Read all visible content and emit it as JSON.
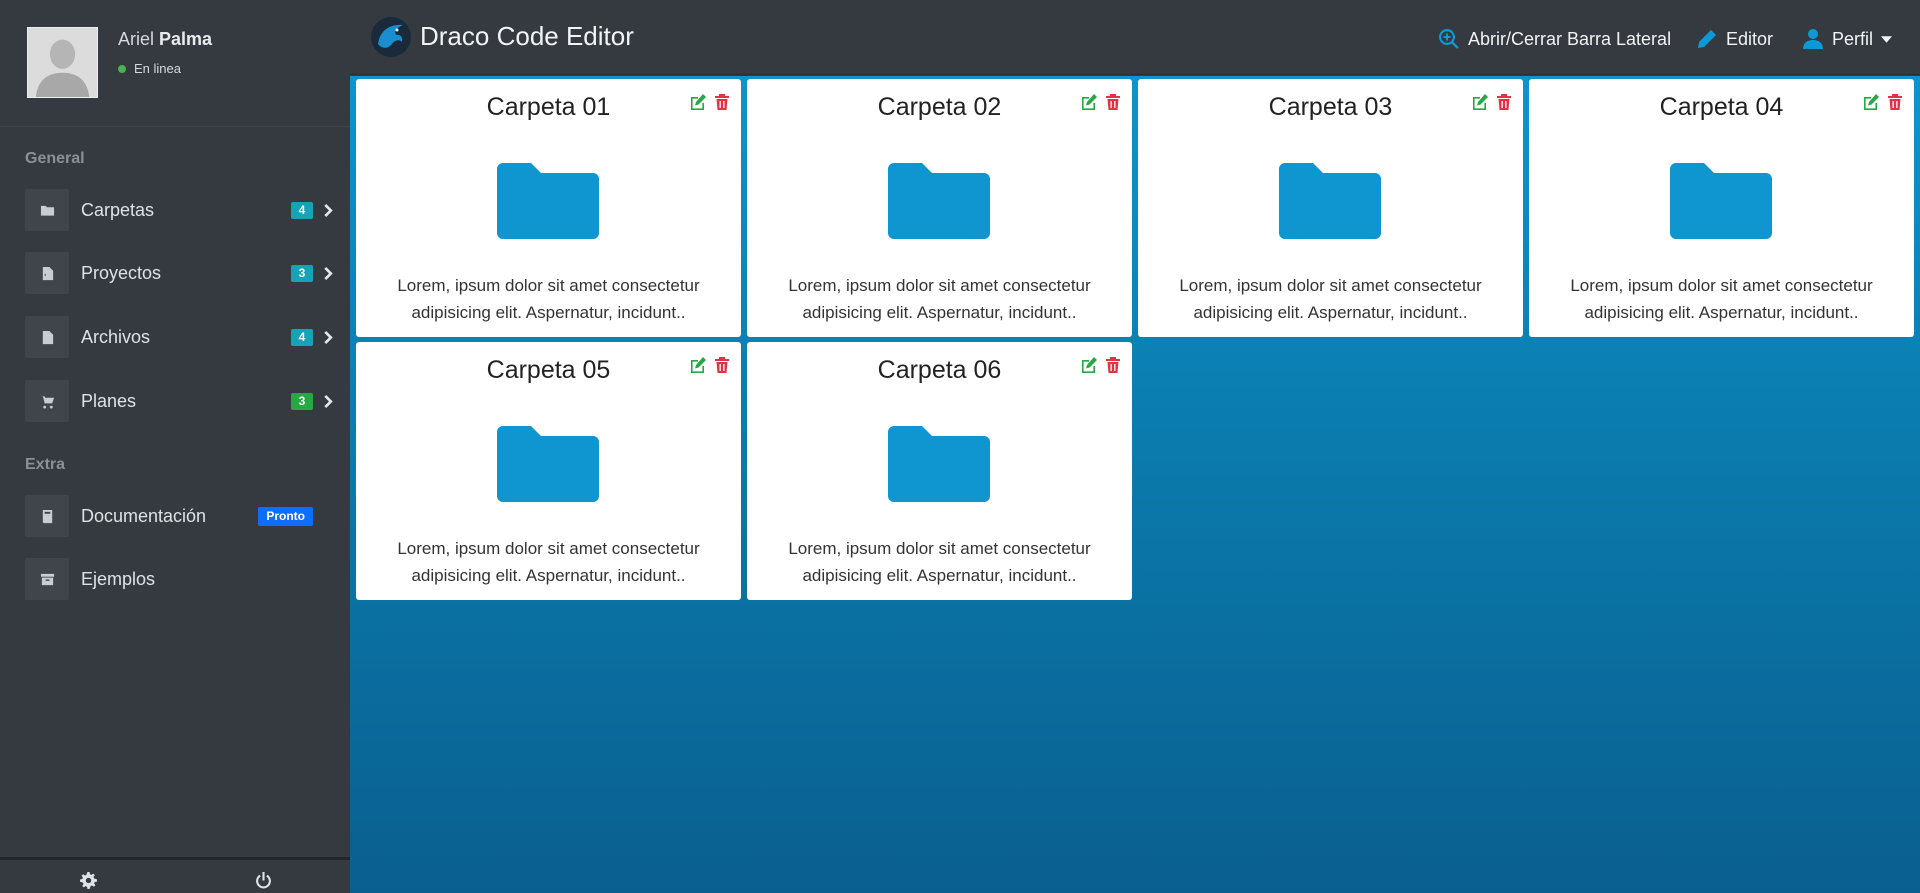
{
  "user": {
    "first_name": "Ariel",
    "last_name": "Palma",
    "status": "En linea"
  },
  "sidebar": {
    "section_general": "General",
    "section_extra": "Extra",
    "items": [
      {
        "label": "Carpetas",
        "badge": "4",
        "badge_color": "#17a2b8",
        "icon": "folder-icon"
      },
      {
        "label": "Proyectos",
        "badge": "3",
        "badge_color": "#17a2b8",
        "icon": "file-code-icon"
      },
      {
        "label": "Archivos",
        "badge": "4",
        "badge_color": "#17a2b8",
        "icon": "file-icon"
      },
      {
        "label": "Planes",
        "badge": "3",
        "badge_color": "#28a745",
        "icon": "cart-icon"
      }
    ],
    "extra_items": [
      {
        "label": "Documentación",
        "pill": "Pronto",
        "icon": "book-icon"
      },
      {
        "label": "Ejemplos",
        "icon": "archive-icon"
      }
    ]
  },
  "topbar": {
    "title": "Draco Code Editor",
    "toggle_label": "Abrir/Cerrar Barra Lateral",
    "editor_label": "Editor",
    "profile_label": "Perfil"
  },
  "colors": {
    "accent": "#0c9ad6",
    "edit": "#28a745",
    "delete": "#dc3545",
    "folder": "#0f95cf"
  },
  "cards": [
    {
      "title": "Carpeta 01",
      "line1": "Lorem, ipsum dolor sit amet consectetur",
      "line2": "adipisicing elit. Aspernatur, incidunt.."
    },
    {
      "title": "Carpeta 02",
      "line1": "Lorem, ipsum dolor sit amet consectetur",
      "line2": "adipisicing elit. Aspernatur, incidunt.."
    },
    {
      "title": "Carpeta 03",
      "line1": "Lorem, ipsum dolor sit amet consectetur",
      "line2": "adipisicing elit. Aspernatur, incidunt.."
    },
    {
      "title": "Carpeta 04",
      "line1": "Lorem, ipsum dolor sit amet consectetur",
      "line2": "adipisicing elit. Aspernatur, incidunt.."
    },
    {
      "title": "Carpeta 05",
      "line1": "Lorem, ipsum dolor sit amet consectetur",
      "line2": "adipisicing elit. Aspernatur, incidunt.."
    },
    {
      "title": "Carpeta 06",
      "line1": "Lorem, ipsum dolor sit amet consectetur",
      "line2": "adipisicing elit. Aspernatur, incidunt.."
    }
  ]
}
